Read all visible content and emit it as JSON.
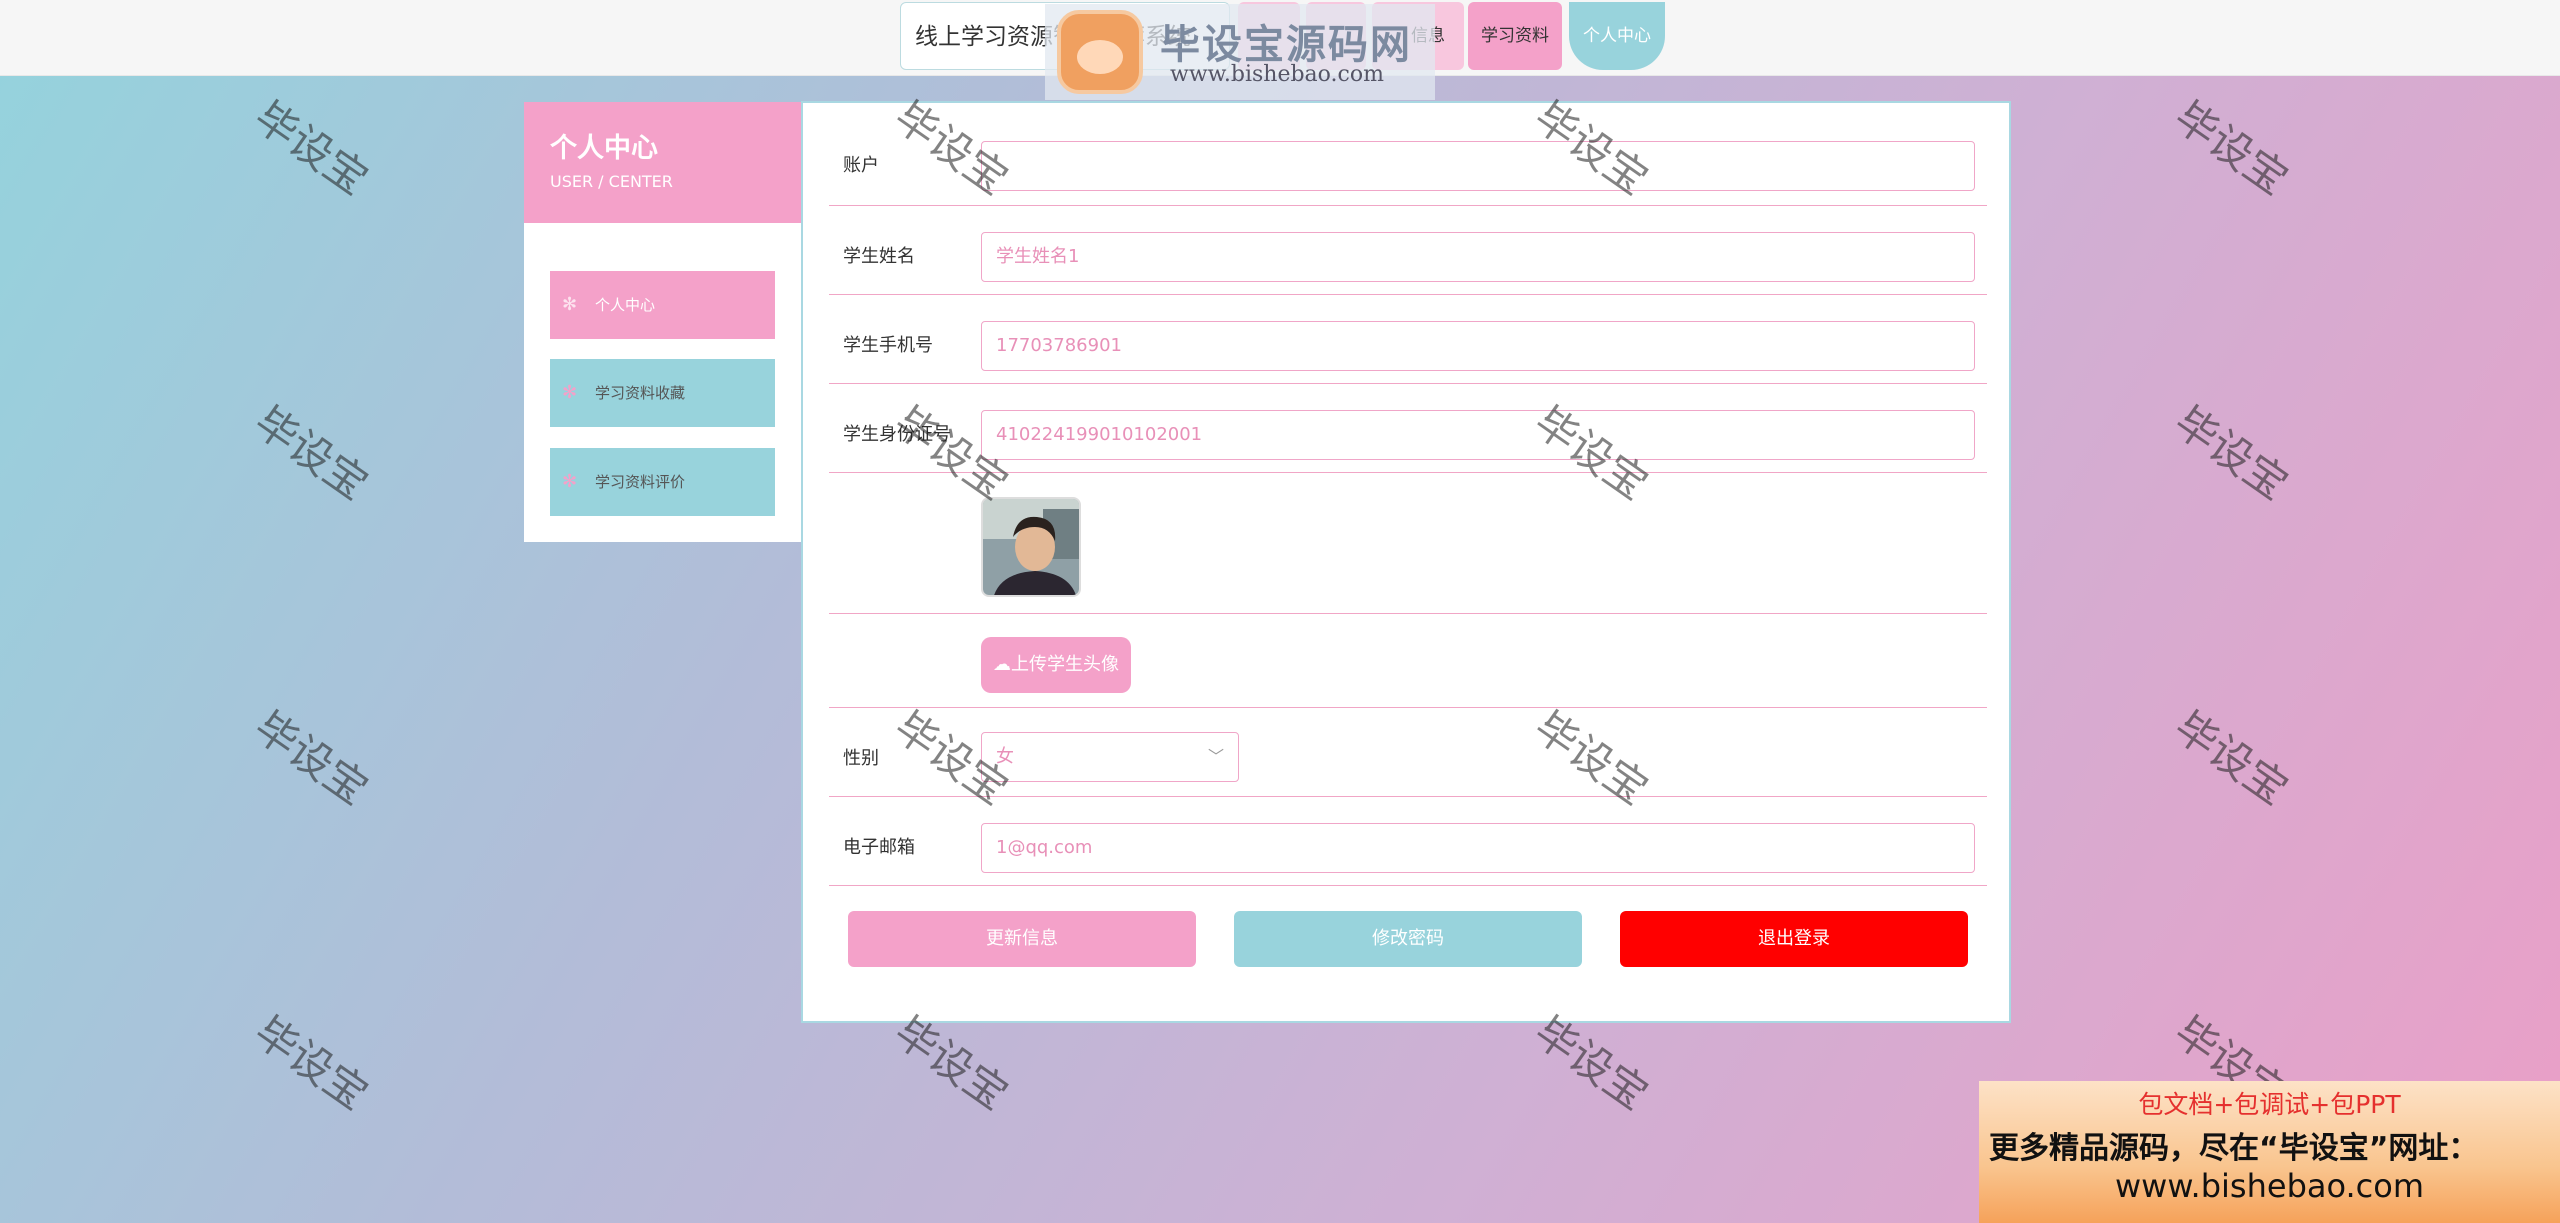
{
  "nav": {
    "site_title": "线上学习资源智能推荐系统",
    "items": [
      "",
      "",
      "信息",
      "学习资料",
      "个人中心"
    ]
  },
  "watermark": {
    "logo_title": "毕设宝源码网",
    "logo_url": "www.bishebao.com",
    "tile_text": "毕设宝"
  },
  "sidebar": {
    "title": "个人中心",
    "subtitle": "USER / CENTER",
    "items": [
      {
        "label": "个人中心",
        "active": true
      },
      {
        "label": "学习资料收藏",
        "active": false
      },
      {
        "label": "学习资料评价",
        "active": false
      }
    ]
  },
  "form": {
    "account_label": "账户",
    "account_value": "",
    "name_label": "学生姓名",
    "name_value": "学生姓名1",
    "phone_label": "学生手机号",
    "phone_value": "17703786901",
    "idcard_label": "学生身份证号",
    "idcard_value": "410224199010102001",
    "upload_button": "上传学生头像",
    "gender_label": "性别",
    "gender_value": "女",
    "email_label": "电子邮箱",
    "email_value": "1@qq.com",
    "update_button": "更新信息",
    "change_pwd_button": "修改密码",
    "logout_button": "退出登录"
  },
  "ad": {
    "line1": "包文档+包调试+包PPT",
    "line2": "更多精品源码，尽在“毕设宝”网址：",
    "line3": "www.bishebao.com"
  },
  "colors": {
    "pink": "#f4a1c9",
    "teal": "#98d3dc",
    "red": "#ff0000"
  }
}
